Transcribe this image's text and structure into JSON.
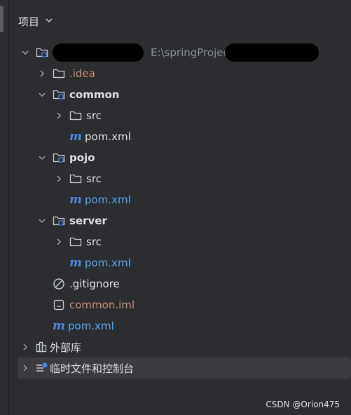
{
  "panel": {
    "title": "项目"
  },
  "tree": {
    "root": {
      "path": "E:\\springProjec"
    },
    "idea": ".idea",
    "common": {
      "name": "common",
      "src": "src",
      "pom": "pom.xml"
    },
    "pojo": {
      "name": "pojo",
      "src": "src",
      "pom": "pom.xml"
    },
    "server": {
      "name": "server",
      "src": "src",
      "pom": "pom.xml"
    },
    "gitignore": ".gitignore",
    "iml": "common.iml",
    "root_pom": "pom.xml",
    "ext_libs": "外部库",
    "scratches": "临时文件和控制台"
  },
  "watermark": "CSDN @Orion475",
  "colors": {
    "background": "#2b2d30",
    "selected": "#393b40",
    "orange": "#cf8e6d",
    "blue": "#56a8f5",
    "maven": "#4a86e8"
  }
}
